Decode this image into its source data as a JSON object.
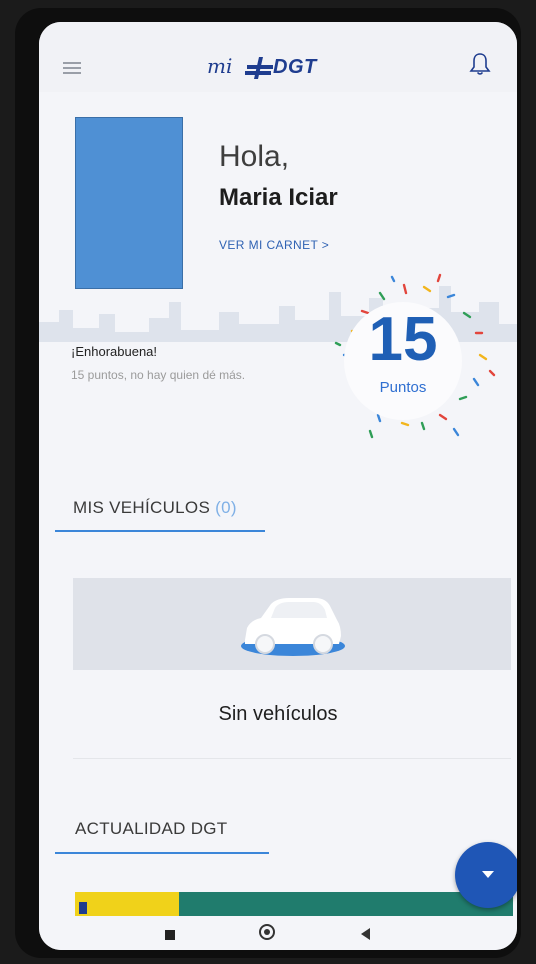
{
  "header": {
    "logo_mi": "mi",
    "logo_dgt": "DGT",
    "menu_icon": "hamburger-menu-icon",
    "notification_icon": "bell-icon"
  },
  "profile": {
    "greeting": "Hola,",
    "name": "Maria Iciar",
    "view_card_link": "VER MI CARNET  >"
  },
  "points": {
    "value": "15",
    "label": "Puntos",
    "message_title": "¡Enhorabuena!",
    "message_body": "15 puntos, no hay quien dé más."
  },
  "vehicles": {
    "title": "MIS VEHÍCULOS",
    "count": "(0)",
    "empty_text": "Sin vehículos"
  },
  "news": {
    "title": "ACTUALIDAD DGT"
  },
  "colors": {
    "accent_blue": "#1f56b6",
    "points_blue": "#1f5fb5",
    "underline_blue": "#3b86d9"
  }
}
